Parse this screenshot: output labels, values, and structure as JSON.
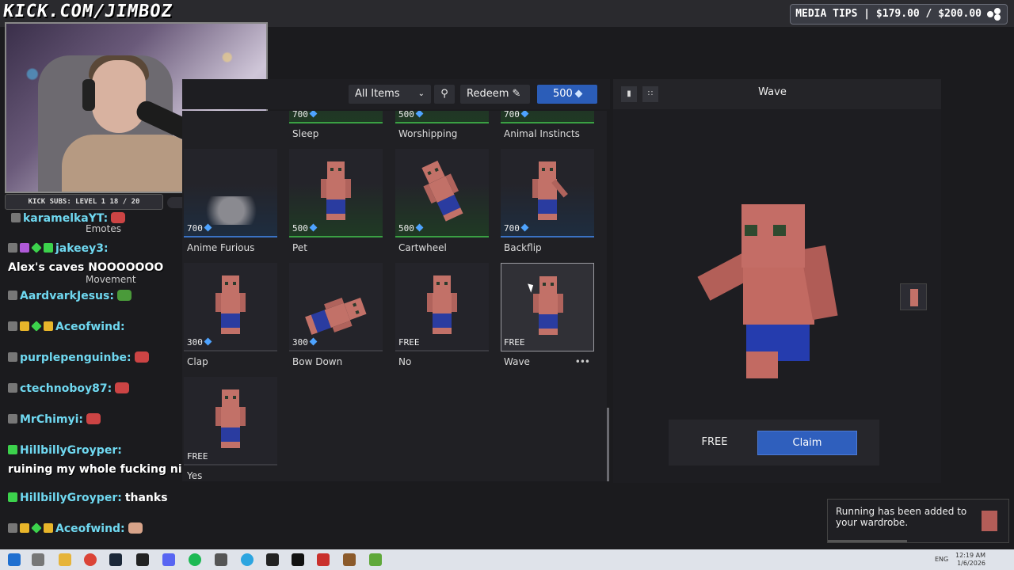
{
  "overlay": {
    "stream_url": "KICK.COM/JIMBOZ",
    "media_tips": "MEDIA TIPS | $179.00 / $200.00",
    "kick_subs": "KICK SUBS: LEVEL 1 18 / 20"
  },
  "chat": [
    {
      "user": "karamelkaYT:",
      "text": ""
    },
    {
      "user": "jakeey3:",
      "text": "Alex's caves NOOOOOOO"
    },
    {
      "user": "AardvarkJesus:",
      "text": ""
    },
    {
      "user": "Aceofwind:",
      "text": ""
    },
    {
      "user": "purplepenguinbe:",
      "text": ""
    },
    {
      "user": "ctechnoboy87:",
      "text": ""
    },
    {
      "user": "MrChimyi:",
      "text": ""
    },
    {
      "user": "HillbillyGroyper:",
      "text": "ruining my whole fucking night"
    },
    {
      "user": "HillbillyGroyper:",
      "text": "thanks"
    },
    {
      "user": "Aceofwind:",
      "text": ""
    }
  ],
  "side_menu": {
    "emotes": "Emotes",
    "movement": "Movement"
  },
  "store": {
    "filter": "All Items",
    "redeem": "Redeem",
    "balance": "500",
    "items": [
      {
        "name": "Sleep",
        "price": "700"
      },
      {
        "name": "Worshipping",
        "price": "500"
      },
      {
        "name": "Animal Instincts",
        "price": "700"
      },
      {
        "name": "Anime Furious",
        "price": "700"
      },
      {
        "name": "Pet",
        "price": "500"
      },
      {
        "name": "Cartwheel",
        "price": "500"
      },
      {
        "name": "Backflip",
        "price": "700"
      },
      {
        "name": "Clap",
        "price": "300"
      },
      {
        "name": "Bow Down",
        "price": "300"
      },
      {
        "name": "No",
        "price": "FREE"
      },
      {
        "name": "Wave",
        "price": "FREE"
      },
      {
        "name": "Yes",
        "price": "FREE"
      }
    ],
    "more": "•••"
  },
  "preview": {
    "title": "Wave",
    "price": "FREE",
    "claim": "Claim"
  },
  "toast": {
    "text": "Running has been added to your wardrobe."
  },
  "taskbar": {
    "lang": "ENG",
    "time": "12:19 AM",
    "date": "1/6/2026"
  },
  "colors": {
    "accent": "#2f5fbd",
    "gem": "#4ea3ff",
    "chat_user": "#6fd8f0"
  }
}
